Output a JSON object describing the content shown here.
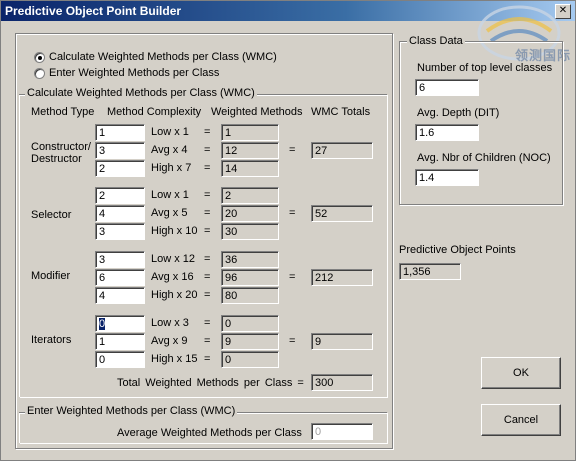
{
  "window": {
    "title": "Predictive Object Point Builder",
    "close_glyph": "✕"
  },
  "watermark": {
    "text": "领测国际"
  },
  "mode": {
    "option_calculate": "Calculate Weighted Methods per Class (WMC)",
    "option_enter": "Enter Weighted Methods per Class",
    "selected": "calculate"
  },
  "calc": {
    "group_label": "Calculate Weighted Methods per Class (WMC)",
    "headers": {
      "method_type": "Method Type",
      "complexity": "Method Complexity",
      "weighted": "Weighted Methods",
      "wmc_totals": "WMC Totals"
    },
    "equals": "=",
    "method_types": [
      {
        "name": "Constructor/\nDestructor",
        "rows": [
          {
            "count": "1",
            "label": "Low x 1",
            "weighted": "1"
          },
          {
            "count": "3",
            "label": "Avg x 4",
            "weighted": "12"
          },
          {
            "count": "2",
            "label": "High x 7",
            "weighted": "14"
          }
        ],
        "total": "27"
      },
      {
        "name": "Selector",
        "rows": [
          {
            "count": "2",
            "label": "Low x 1",
            "weighted": "2"
          },
          {
            "count": "4",
            "label": "Avg x 5",
            "weighted": "20"
          },
          {
            "count": "3",
            "label": "High x 10",
            "weighted": "30"
          }
        ],
        "total": "52"
      },
      {
        "name": "Modifier",
        "rows": [
          {
            "count": "3",
            "label": "Low x 12",
            "weighted": "36"
          },
          {
            "count": "6",
            "label": "Avg x 16",
            "weighted": "96"
          },
          {
            "count": "4",
            "label": "High x 20",
            "weighted": "80"
          }
        ],
        "total": "212"
      },
      {
        "name": "Iterators",
        "rows": [
          {
            "count": "0",
            "label": "Low x 3",
            "weighted": "0"
          },
          {
            "count": "1",
            "label": "Avg x 9",
            "weighted": "9"
          },
          {
            "count": "0",
            "label": "High x 15",
            "weighted": "0"
          }
        ],
        "total": "9"
      }
    ],
    "total_label": "Total Weighted Methods per Class  =",
    "total_value": "300"
  },
  "enter": {
    "group_label": "Enter Weighted Methods per Class (WMC)",
    "avg_label": "Average Weighted Methods per Class",
    "avg_value": "0"
  },
  "class_data": {
    "group_label": "Class Data",
    "top_level_label": "Number of top level classes",
    "top_level_value": "6",
    "depth_label": "Avg. Depth (DIT)",
    "depth_value": "1.6",
    "children_label": "Avg. Nbr of Children (NOC)",
    "children_value": "1.4"
  },
  "predictive": {
    "label": "Predictive Object Points",
    "value": "1,356"
  },
  "buttons": {
    "ok": "OK",
    "cancel": "Cancel"
  }
}
